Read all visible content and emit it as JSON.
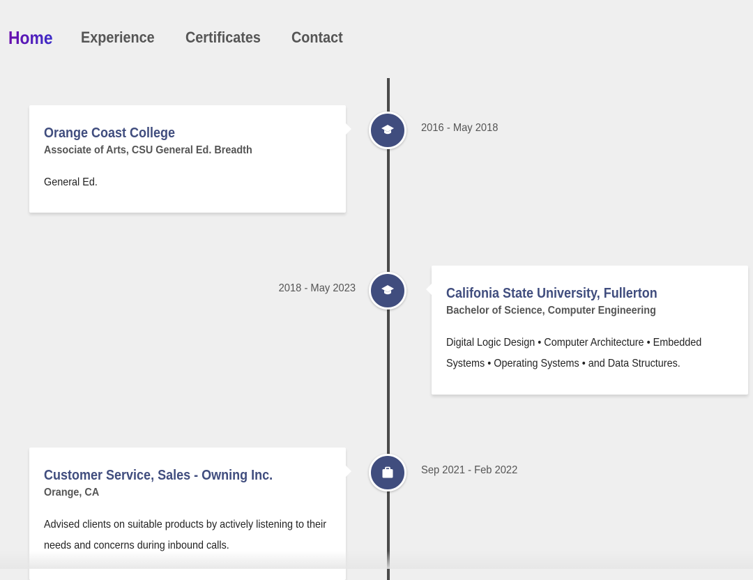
{
  "nav": {
    "items": [
      {
        "label": "Home",
        "active": true
      },
      {
        "label": "Experience",
        "active": false
      },
      {
        "label": "Certificates",
        "active": false
      },
      {
        "label": "Contact",
        "active": false
      }
    ]
  },
  "colors": {
    "accent_gradient_start": "#6a0dad",
    "accent_gradient_end": "#3b2cc8",
    "node_fill": "#404d7e",
    "title_color": "#404d7e",
    "line_color": "#4a4a4a",
    "background": "#efefef"
  },
  "timeline": [
    {
      "icon": "graduation-cap-icon",
      "date": "2016 - May 2018",
      "title": "Orange Coast College",
      "subtitle": "Associate of Arts, CSU General Ed. Breadth",
      "description": "General Ed."
    },
    {
      "icon": "graduation-cap-icon",
      "date": "2018 - May 2023",
      "title": "Califonia State University, Fullerton",
      "subtitle": "Bachelor of Science, Computer Engineering",
      "description": "Digital Logic Design • Computer Architecture • Embedded Systems • Operating Systems • and Data Structures."
    },
    {
      "icon": "briefcase-icon",
      "date": "Sep 2021 - Feb 2022",
      "title": "Customer Service, Sales - Owning Inc.",
      "subtitle": "Orange, CA",
      "description": "Advised clients on suitable products by actively listening to their needs and concerns during inbound calls."
    }
  ]
}
